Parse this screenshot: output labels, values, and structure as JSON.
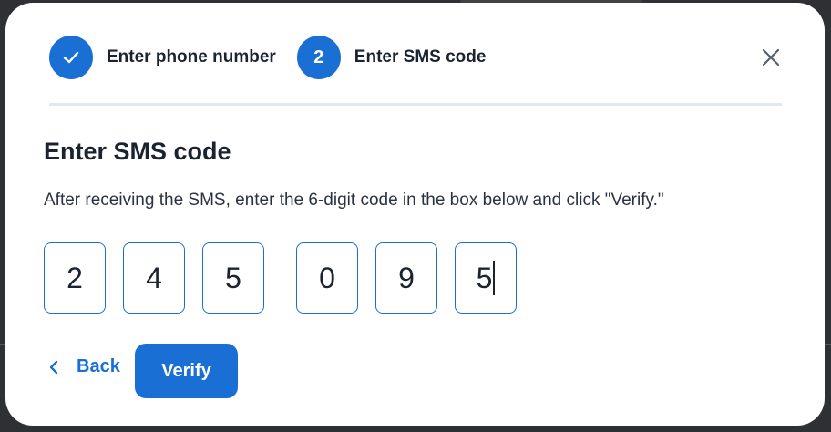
{
  "stepper": {
    "steps": [
      {
        "label": "Enter phone number",
        "marker": "",
        "status": "completed"
      },
      {
        "label": "Enter SMS code",
        "marker": "2",
        "status": "current"
      }
    ]
  },
  "dialog": {
    "title": "Enter SMS code",
    "instruction": "After receiving the SMS, enter the 6-digit code in the box below and click \"Verify.\"",
    "code_digits": [
      "2",
      "4",
      "5",
      "0",
      "9",
      "5"
    ]
  },
  "actions": {
    "back_label": "Back",
    "verify_label": "Verify"
  },
  "icons": {
    "completed_step": "check-icon",
    "close": "close-icon",
    "back": "chevron-left-icon"
  },
  "colors": {
    "accent": "#1a6fd4",
    "text": "#1b2330",
    "divider": "#e3e8ec"
  }
}
